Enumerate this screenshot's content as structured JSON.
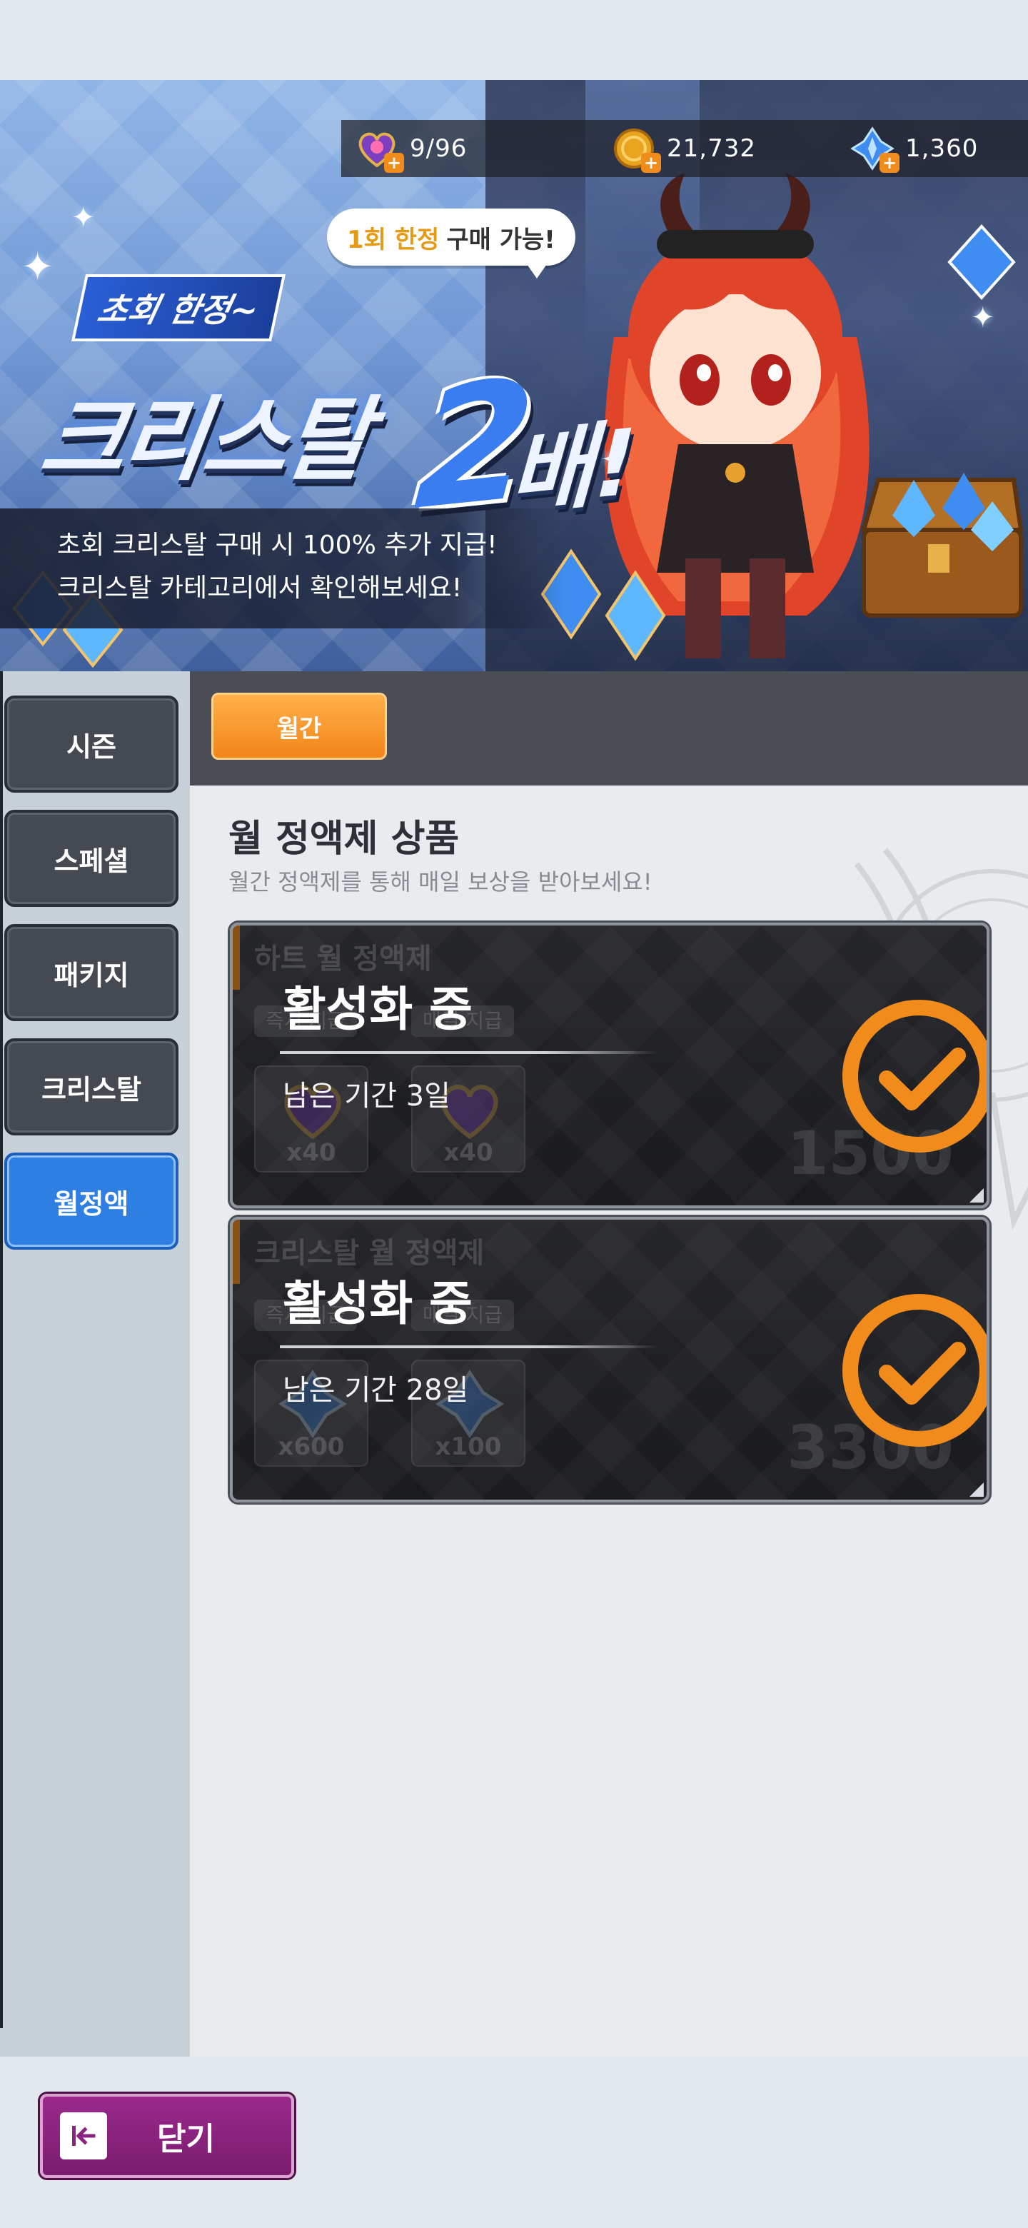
{
  "currencies": [
    {
      "name": "heart-potion-icon",
      "value": "9/96"
    },
    {
      "name": "gold-coin-icon",
      "value": "21,732"
    },
    {
      "name": "crystal-icon",
      "value": "1,360"
    }
  ],
  "banner": {
    "limit_highlight": "1회 한정",
    "limit_rest": "구매 가능!",
    "promo_tag": "초회 한정~",
    "promo_title": "크리스탈",
    "promo_number": "2",
    "promo_suffix": "배!",
    "desc_line1": "초회 크리스탈 구매 시 100% 추가 지급!",
    "desc_line2": "크리스탈 카테고리에서 확인해보세요!"
  },
  "sidebar": {
    "items": [
      {
        "label": "시즌"
      },
      {
        "label": "스페셜"
      },
      {
        "label": "패키지"
      },
      {
        "label": "크리스탈"
      },
      {
        "label": "월정액"
      }
    ],
    "active_index": 4
  },
  "tabs": [
    {
      "label": "월간"
    }
  ],
  "section": {
    "title": "월 정액제 상품",
    "subtitle": "월간 정액제를 통해 매일 보상을 받아보세요!"
  },
  "products": [
    {
      "name": "하트 월 정액제",
      "tag_left": "즉시 지급",
      "tag_right": "매일 지급",
      "item_left_qty": "x40",
      "item_right_qty": "x40",
      "price": "1500",
      "status": "활성화 중",
      "remaining": "남은 기간 3일"
    },
    {
      "name": "크리스탈 월 정액제",
      "tag_left": "즉시 지급",
      "tag_right": "매일 지급",
      "item_left_qty": "x600",
      "item_right_qty": "x100",
      "price": "3300",
      "status": "활성화 중",
      "remaining": "남은 기간 28일"
    }
  ],
  "close_button": {
    "label": "닫기"
  },
  "colors": {
    "accent_orange": "#f08b1c",
    "active_blue": "#2f7fe3",
    "close_purple": "#8a2480"
  }
}
